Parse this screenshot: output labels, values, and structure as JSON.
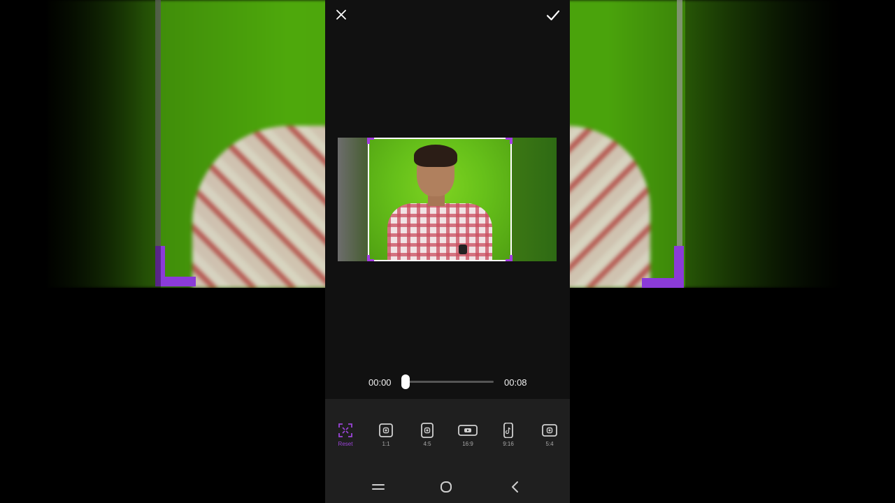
{
  "editor": {
    "close_icon": "close-icon",
    "confirm_icon": "checkmark-icon"
  },
  "timeline": {
    "current_time": "00:00",
    "total_time": "00:08",
    "progress": 0.0
  },
  "ratios": [
    {
      "label": "Reset",
      "icon": "crop-reset-icon",
      "active": true
    },
    {
      "label": "1:1",
      "icon": "instagram-icon",
      "active": false
    },
    {
      "label": "4:5",
      "icon": "instagram-icon",
      "active": false
    },
    {
      "label": "16:9",
      "icon": "youtube-icon",
      "active": false
    },
    {
      "label": "9:16",
      "icon": "tiktok-icon",
      "active": false
    },
    {
      "label": "5:4",
      "icon": "instagram-icon",
      "active": false
    }
  ],
  "colors": {
    "accent": "#9b44d8",
    "panel": "#111111",
    "toolbar": "#1f1f1f"
  },
  "system_nav": [
    "recents-icon",
    "home-icon",
    "back-icon"
  ]
}
